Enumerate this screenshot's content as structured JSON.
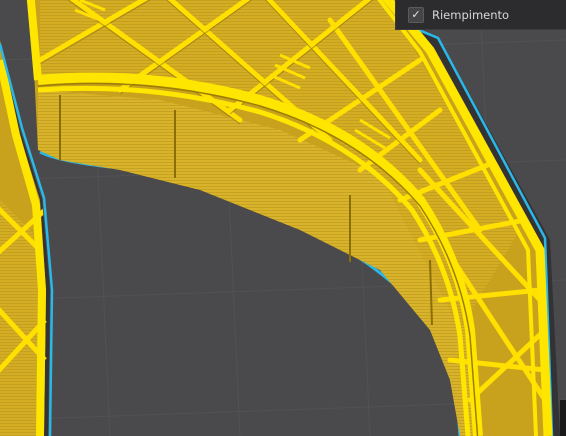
{
  "legend": {
    "infill_checkbox_checked": true,
    "infill_check_glyph": "✓",
    "infill_label": "Riempimento"
  },
  "colors": {
    "build_plate": "#4a4a4c",
    "plate_grid": "#545456",
    "outer_wall": "#ffd900",
    "wall_dark": "#b39400",
    "infill": "#d9b42a",
    "skirt": "#29b8e8",
    "panel_background": "#2c2c2e"
  },
  "icons": {
    "checkbox": "check-icon"
  }
}
